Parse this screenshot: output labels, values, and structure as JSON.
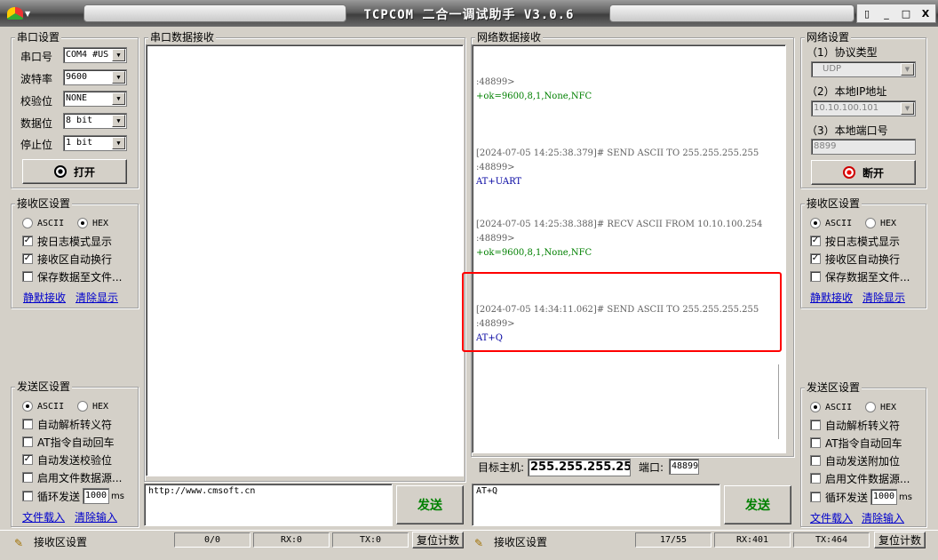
{
  "window": {
    "title": "TCPCOM 二合一调试助手  V3.0.6",
    "btn_pin": "▯",
    "btn_min": "_",
    "btn_max": "□",
    "btn_close": "X"
  },
  "serial_settings": {
    "title": "串口设置",
    "port_label": "串口号",
    "port_value": "COM4 #US",
    "baud_label": "波特率",
    "baud_value": "9600",
    "parity_label": "校验位",
    "parity_value": "NONE",
    "databits_label": "数据位",
    "databits_value": "8 bit",
    "stopbits_label": "停止位",
    "stopbits_value": "1 bit",
    "open_label": "打开"
  },
  "left_recv": {
    "title": "接收区设置",
    "ascii": "ASCII",
    "hex": "HEX",
    "selected": "hex",
    "log_mode": "按日志模式显示",
    "log_mode_checked": true,
    "auto_wrap": "接收区自动换行",
    "auto_wrap_checked": true,
    "save_file": "保存数据至文件...",
    "save_file_checked": false,
    "silent": "静默接收",
    "clear": "清除显示"
  },
  "left_send": {
    "title": "发送区设置",
    "ascii": "ASCII",
    "hex": "HEX",
    "selected": "ascii",
    "auto_escape": "自动解析转义符",
    "auto_escape_checked": false,
    "at_cr": "AT指令自动回车",
    "at_cr_checked": false,
    "auto_check": "自动发送校验位",
    "auto_check_checked": true,
    "file_src": "启用文件数据源...",
    "file_src_checked": false,
    "loop": "循环发送",
    "loop_checked": false,
    "loop_value": "1000",
    "loop_unit": "ms",
    "load": "文件载入",
    "clear": "清除输入"
  },
  "serial_recv": {
    "title": "串口数据接收"
  },
  "serial_send": {
    "text": "http://www.cmsoft.cn",
    "send_label": "发送"
  },
  "net_recv": {
    "title": "网络数据接收",
    "lines": [
      {
        "text": ":48899>",
        "color": "gray"
      },
      {
        "text": "+ok=9600,8,1,None,NFC",
        "color": "green"
      },
      {
        "text": "",
        "color": "gray"
      },
      {
        "text": "",
        "color": "gray"
      },
      {
        "text": "",
        "color": "gray"
      },
      {
        "text": "[2024-07-05 14:25:38.379]# SEND ASCII TO 255.255.255.255",
        "color": "gray"
      },
      {
        "text": ":48899>",
        "color": "gray"
      },
      {
        "text": "AT+UART",
        "color": "blue"
      },
      {
        "text": "",
        "color": "gray"
      },
      {
        "text": "",
        "color": "gray"
      },
      {
        "text": "[2024-07-05 14:25:38.388]# RECV ASCII FROM 10.10.100.254",
        "color": "gray"
      },
      {
        "text": ":48899>",
        "color": "gray"
      },
      {
        "text": "+ok=9600,8,1,None,NFC",
        "color": "green"
      },
      {
        "text": "",
        "color": "gray"
      },
      {
        "text": "",
        "color": "gray"
      },
      {
        "text": "",
        "color": "gray"
      },
      {
        "text": "[2024-07-05 14:34:11.062]# SEND ASCII TO 255.255.255.255",
        "color": "gray"
      },
      {
        "text": ":48899>",
        "color": "gray"
      },
      {
        "text": "AT+Q",
        "color": "blue"
      }
    ]
  },
  "target": {
    "host_label": "目标主机:",
    "host_value": "255.255.255.255",
    "port_label": "端口:",
    "port_value": "48899"
  },
  "net_send": {
    "text": "AT+Q",
    "send_label": "发送"
  },
  "network_settings": {
    "title": "网络设置",
    "proto_label": "（1）协议类型",
    "proto_value": "UDP",
    "ip_label": "（2）本地IP地址",
    "ip_value": "10.10.100.101",
    "port_label": "（3）本地端口号",
    "port_value": "8899",
    "disconnect_label": "断开"
  },
  "right_recv": {
    "title": "接收区设置",
    "ascii": "ASCII",
    "hex": "HEX",
    "selected": "ascii",
    "log_mode": "按日志模式显示",
    "log_mode_checked": true,
    "auto_wrap": "接收区自动换行",
    "auto_wrap_checked": true,
    "save_file": "保存数据至文件...",
    "save_file_checked": false,
    "silent": "静默接收",
    "clear": "清除显示"
  },
  "right_send": {
    "title": "发送区设置",
    "ascii": "ASCII",
    "hex": "HEX",
    "selected": "ascii",
    "auto_escape": "自动解析转义符",
    "auto_escape_checked": false,
    "at_cr": "AT指令自动回车",
    "at_cr_checked": false,
    "auto_append": "自动发送附加位",
    "auto_append_checked": false,
    "file_src": "启用文件数据源...",
    "file_src_checked": false,
    "loop": "循环发送",
    "loop_checked": false,
    "loop_value": "1000",
    "loop_unit": "ms",
    "load": "文件载入",
    "clear": "清除输入"
  },
  "status_left": {
    "label": "接收区设置",
    "count": "0/0",
    "rx": "RX:0",
    "tx": "TX:0",
    "reset": "复位计数"
  },
  "status_right": {
    "label": "接收区设置",
    "count": "17/55",
    "rx": "RX:401",
    "tx": "TX:464",
    "reset": "复位计数"
  },
  "colors": {
    "highlight": "#ff0000",
    "send_green": "#008000"
  }
}
